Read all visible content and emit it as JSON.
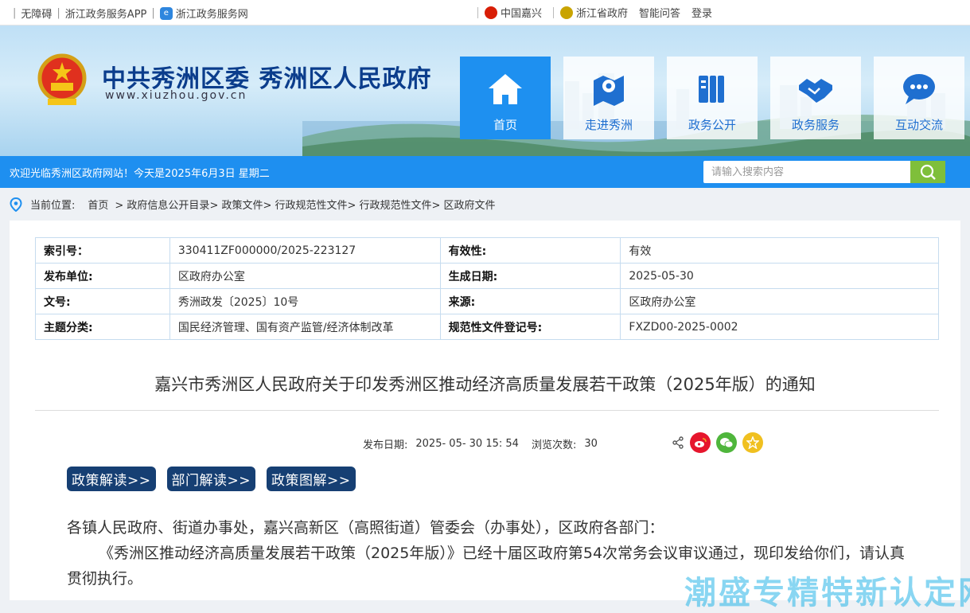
{
  "topbar": {
    "accessibility": "无障碍",
    "app": "浙江政务服务APP",
    "web": "浙江政务服务网",
    "china_jiaxing": "中国嘉兴",
    "zj_gov": "浙江省政府",
    "qa": "智能问答",
    "login": "登录"
  },
  "header": {
    "title": "中共秀洲区委 秀洲区人民政府",
    "url": "www.xiuzhou.gov.cn",
    "nav": [
      {
        "label": "首页",
        "icon": "home-icon",
        "active": true
      },
      {
        "label": "走进秀洲",
        "icon": "map-pin-icon",
        "active": false
      },
      {
        "label": "政务公开",
        "icon": "document-icon",
        "active": false
      },
      {
        "label": "政务服务",
        "icon": "handshake-icon",
        "active": false
      },
      {
        "label": "互动交流",
        "icon": "chat-icon",
        "active": false
      }
    ]
  },
  "welcome": {
    "message": "欢迎光临秀洲区政府网站！今天是2025年6月3日 星期二",
    "search_placeholder": "请输入搜索内容"
  },
  "breadcrumb": {
    "label": "当前位置:",
    "items": [
      "首页",
      "> 政府信息公开目录",
      "> 政策文件",
      "> 行政规范性文件",
      "> 行政规范性文件",
      "> 区政府文件"
    ]
  },
  "meta": {
    "rows": [
      {
        "k1": "索引号：",
        "v1": "330411ZF000000/2025-223127",
        "k2": "有效性:",
        "v2": "有效"
      },
      {
        "k1": "发布单位:",
        "v1": "区政府办公室",
        "k2": "生成日期:",
        "v2": "2025-05-30"
      },
      {
        "k1": "文号:",
        "v1": "秀洲政发〔2025〕10号",
        "k2": "来源:",
        "v2": "区政府办公室"
      },
      {
        "k1": "主题分类:",
        "v1": "国民经济管理、国有资产监管/经济体制改革",
        "k2": "规范性文件登记号:",
        "v2": "FXZD00-2025-0002"
      }
    ]
  },
  "article": {
    "title": "嘉兴市秀洲区人民政府关于印发秀洲区推动经济高质量发展若干政策（2025年版）的通知",
    "publish_label": "发布日期:",
    "publish_date": "2025- 05- 30 15: 54",
    "views_label": "浏览次数:",
    "views": "30",
    "tags": [
      "政策解读>>",
      "部门解读>>",
      "政策图解>>"
    ],
    "para1": "各镇人民政府、街道办事处，嘉兴高新区（高照街道）管委会（办事处），区政府各部门：",
    "para2": "《秀洲区推动经济高质量发展若干政策（2025年版）》已经十届区政府第54次常务会议审议通过，现印发给你们，请认真贯彻执行。"
  },
  "watermark": "潮盛专精特新认定网",
  "colors": {
    "primary": "#1e8ff0",
    "title": "#0b3d8c",
    "tag": "#163f73",
    "search_btn": "#7fbf3a"
  }
}
